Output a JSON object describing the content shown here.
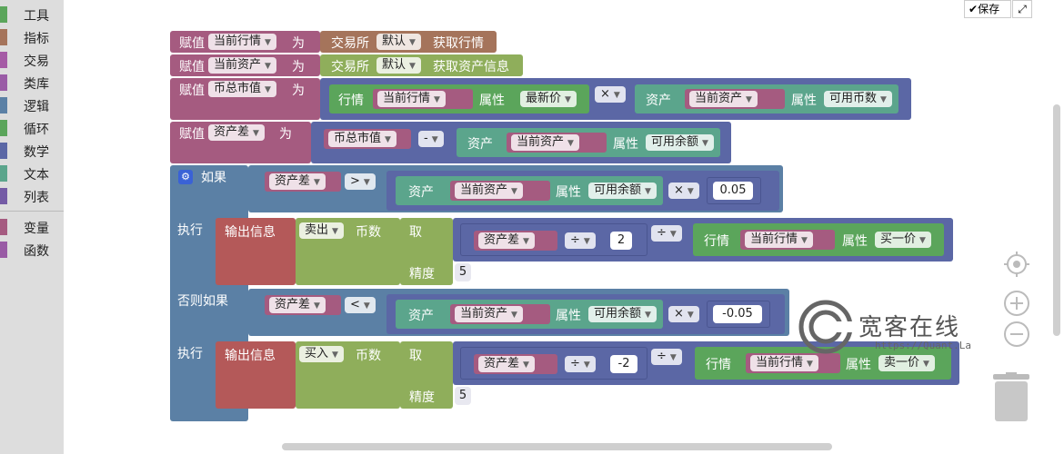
{
  "sidebar": {
    "categories": [
      {
        "label": "工具",
        "color": "#5ba55b"
      },
      {
        "label": "指标",
        "color": "#a5745b"
      },
      {
        "label": "交易",
        "color": "#a55ba5"
      },
      {
        "label": "类库",
        "color": "#9a5ca6"
      },
      {
        "label": "逻辑",
        "color": "#5b80a5"
      },
      {
        "label": "循环",
        "color": "#5ba55b"
      },
      {
        "label": "数学",
        "color": "#5b67a5"
      },
      {
        "label": "文本",
        "color": "#5ba58c"
      },
      {
        "label": "列表",
        "color": "#745ba5"
      },
      {
        "label": "变量",
        "color": "#a55b80"
      },
      {
        "label": "函数",
        "color": "#995ba5"
      }
    ]
  },
  "toolbar": {
    "save_label": "保存"
  },
  "watermark": {
    "title": "宽客在线",
    "url": "https://Quant.La"
  },
  "blocks": {
    "b1": {
      "assign": "赋值",
      "var": "当前行情",
      "as": "为",
      "exchange": "交易所",
      "default": "默认",
      "action": "获取行情"
    },
    "b2": {
      "assign": "赋值",
      "var": "当前资产",
      "as": "为",
      "exchange": "交易所",
      "default": "默认",
      "action": "获取资产信息"
    },
    "b3": {
      "assign": "赋值",
      "var": "币总市值",
      "as": "为",
      "ticker": "行情",
      "ticker_var": "当前行情",
      "attr": "属性",
      "attr_val": "最新价",
      "op": "×",
      "asset": "资产",
      "asset_var": "当前资产",
      "attr2": "属性",
      "attr2_val": "可用币数"
    },
    "b4": {
      "assign": "赋值",
      "var": "资产差",
      "as": "为",
      "left_var": "币总市值",
      "op": "-",
      "asset": "资产",
      "asset_var": "当前资产",
      "attr": "属性",
      "attr_val": "可用余额"
    },
    "if": {
      "if_label": "如果",
      "do_label": "执行",
      "elseif_label": "否则如果",
      "c1": {
        "var": "资产差",
        "cmp": ">",
        "asset": "资产",
        "asset_var": "当前资产",
        "attr": "属性",
        "attr_val": "可用余额",
        "op": "×",
        "num": "0.05"
      },
      "d1": {
        "print": "输出信息",
        "trade": "卖出",
        "coin": "币数",
        "take": "取",
        "var": "资产差",
        "div": "÷",
        "num": "2",
        "div2": "÷",
        "ticker": "行情",
        "ticker_var": "当前行情",
        "attr": "属性",
        "attr_val": "买一价",
        "precision": "精度",
        "precision_val": "5"
      },
      "c2": {
        "var": "资产差",
        "cmp": "<",
        "asset": "资产",
        "asset_var": "当前资产",
        "attr": "属性",
        "attr_val": "可用余额",
        "op": "×",
        "num": "-0.05"
      },
      "d2": {
        "print": "输出信息",
        "trade": "买入",
        "coin": "币数",
        "take": "取",
        "var": "资产差",
        "div": "÷",
        "num": "-2",
        "div2": "÷",
        "ticker": "行情",
        "ticker_var": "当前行情",
        "attr": "属性",
        "attr_val": "卖一价",
        "precision": "精度",
        "precision_val": "5"
      }
    }
  }
}
